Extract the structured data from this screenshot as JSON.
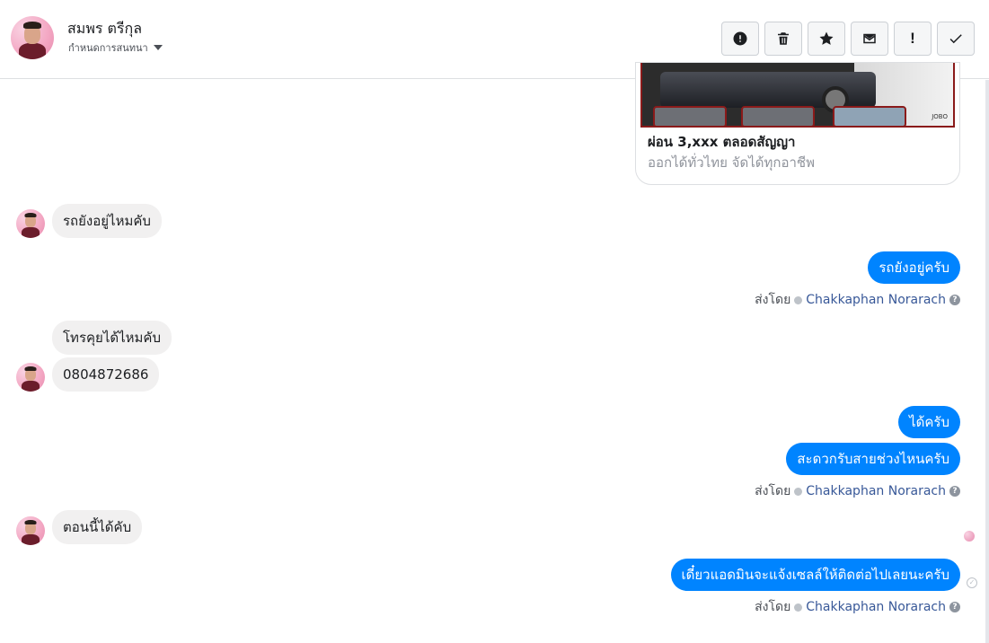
{
  "header": {
    "contact_name": "สมพร ตรีกุล",
    "assign_label": "กำหนดการสนทนา",
    "toolbar": {
      "icons": [
        "spam-icon",
        "trash-icon",
        "star-icon",
        "envelope-icon",
        "exclamation-icon",
        "check-icon"
      ],
      "exclamation_glyph": "!"
    }
  },
  "card": {
    "title": "ผ่อน 3,xxx ตลอดสัญญา",
    "subtitle": "ออกได้ทั่วไทย จัดได้ทุกอาชีพ",
    "brand_text": "JOBO"
  },
  "messages": [
    {
      "direction": "in",
      "text": "รถยังอยู่ไหมคับ"
    },
    {
      "direction": "out",
      "text": "รถยังอยู่ครับ"
    },
    {
      "direction": "in",
      "text": "โทรคุยได้ไหมคับ"
    },
    {
      "direction": "in",
      "text": "0804872686"
    },
    {
      "direction": "out",
      "text": "ได้ครับ"
    },
    {
      "direction": "out",
      "text": "สะดวกรับสายช่วงไหนครับ"
    },
    {
      "direction": "in",
      "text": "ตอนนี้ได้คับ"
    },
    {
      "direction": "out",
      "text": "เดี๋ยวแอดมินจะแจ้งเซลล์ให้ติดต่อไปเลยนะครับ"
    }
  ],
  "sent_by": {
    "prefix": "ส่งโดย",
    "agent": "Chakkaphan Norarach",
    "help_glyph": "?"
  },
  "seen_glyph": "✓",
  "colors": {
    "outgoing": "#0084ff",
    "incoming": "#f1f0f0",
    "agent_link": "#385898"
  }
}
